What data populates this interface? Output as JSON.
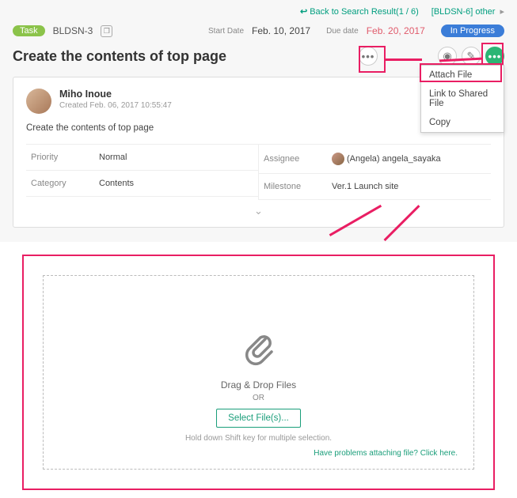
{
  "nav": {
    "back": "Back to Search Result(1 / 6)",
    "other": "[BLDSN-6] other"
  },
  "meta": {
    "type_label": "Task",
    "key": "BLDSN-3",
    "start_label": "Start Date",
    "start_val": "Feb. 10, 2017",
    "due_label": "Due date",
    "due_val": "Feb. 20, 2017",
    "status": "In Progress"
  },
  "title": "Create the contents of top page",
  "dropdown": {
    "attach": "Attach File",
    "link": "Link to Shared File",
    "copy": "Copy"
  },
  "card": {
    "user": "Miho Inoue",
    "created_label": "Created",
    "created_val": "Feb. 06, 2017 10:55:47",
    "body": "Create the contents of top page",
    "fields": {
      "priority_lbl": "Priority",
      "priority_val": "Normal",
      "category_lbl": "Category",
      "category_val": "Contents",
      "assignee_lbl": "Assignee",
      "assignee_val": "(Angela) angela_sayaka",
      "milestone_lbl": "Milestone",
      "milestone_val": "Ver.1 Launch site"
    }
  },
  "upload": {
    "drag": "Drag & Drop Files",
    "or": "OR",
    "select": "Select File(s)...",
    "hint": "Hold down Shift key for multiple selection.",
    "problems": "Have problems attaching file? Click here."
  }
}
